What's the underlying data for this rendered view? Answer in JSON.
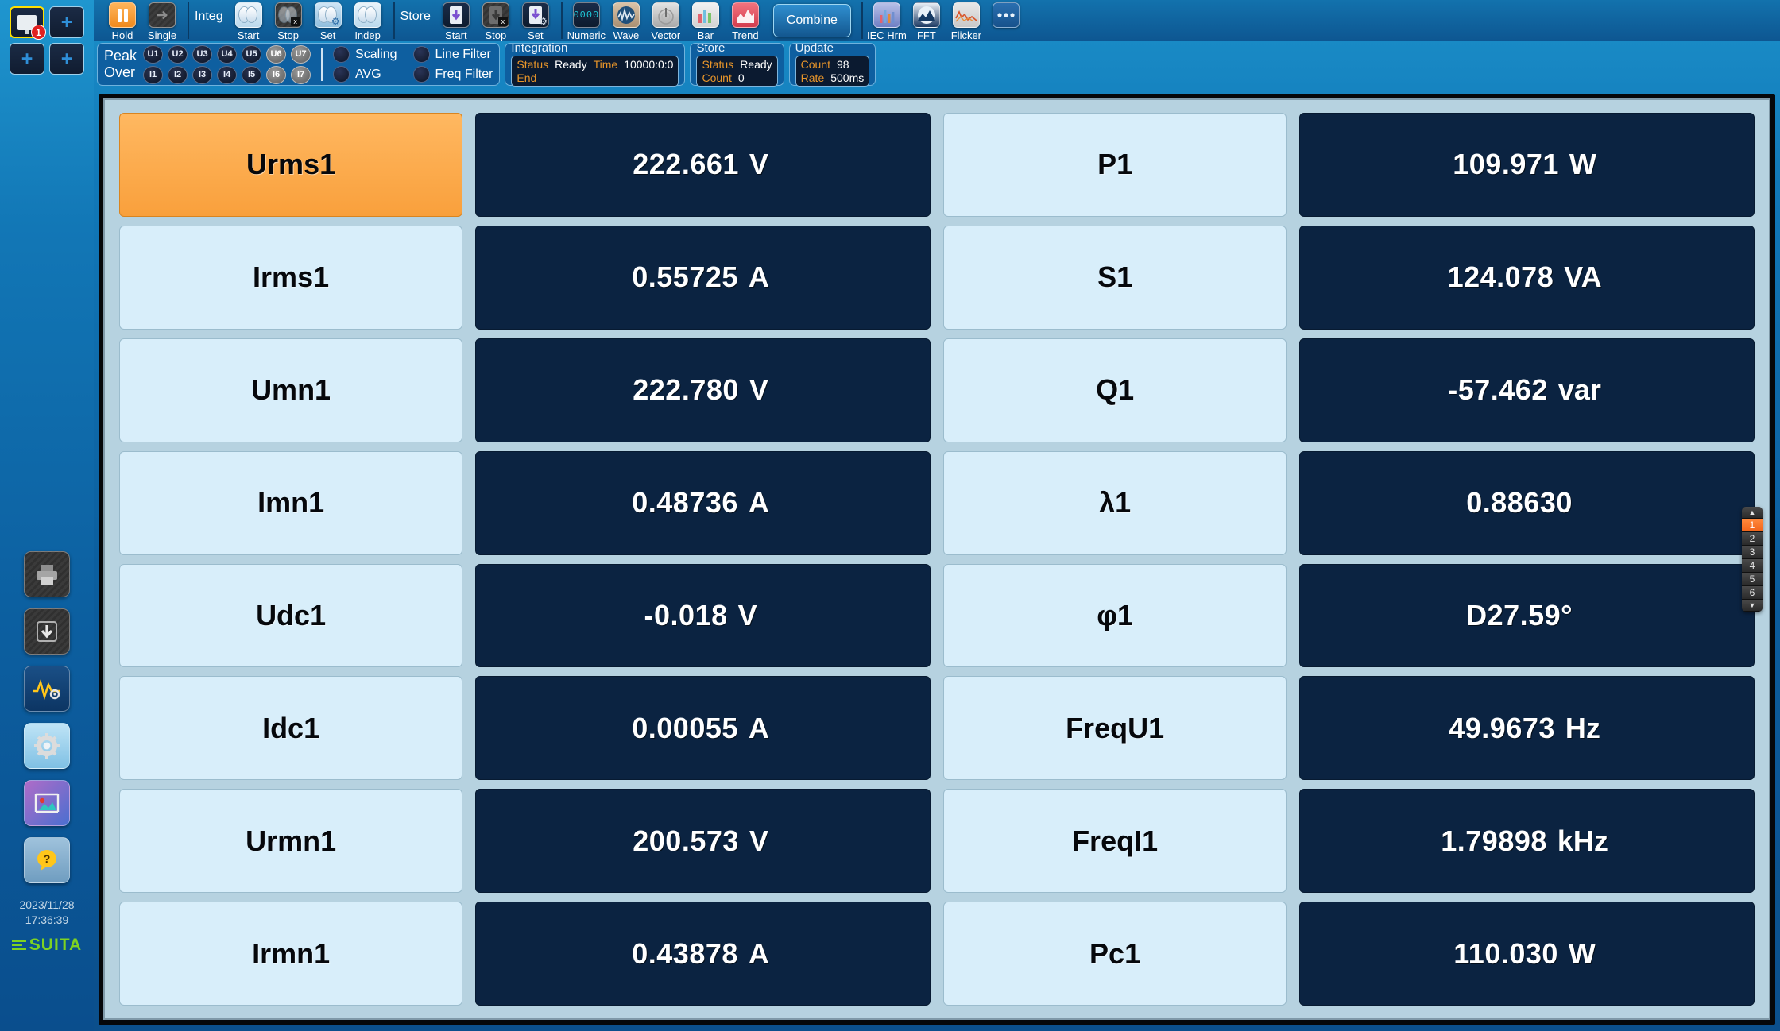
{
  "window_tiles": [
    {
      "name": "monitor-1",
      "badge": "1",
      "active": true
    },
    {
      "name": "add-2",
      "label": "+",
      "active": false
    },
    {
      "name": "add-3",
      "label": "+",
      "active": false
    },
    {
      "name": "add-4",
      "label": "+",
      "active": false
    }
  ],
  "sidebar": {
    "icons": [
      "print-icon",
      "save-icon",
      "waveform-settings-icon",
      "gear-icon",
      "image-capture-icon",
      "help-icon"
    ],
    "date": "2023/11/28",
    "time": "17:36:39",
    "logo": "SUITA"
  },
  "toolbar": {
    "groups": [
      {
        "name": "run-control",
        "title": "",
        "buttons": [
          {
            "label": "Hold",
            "icon": "pause-icon"
          },
          {
            "label": "Single",
            "icon": "single-arrow-icon"
          }
        ]
      },
      {
        "name": "integration",
        "title": "Integ",
        "buttons": [
          {
            "label": "Start",
            "icon": "integ-start-icon"
          },
          {
            "label": "Stop",
            "icon": "integ-stop-icon"
          },
          {
            "label": "Set",
            "icon": "integ-set-icon"
          },
          {
            "label": "Indep",
            "icon": "integ-indep-icon"
          }
        ]
      },
      {
        "name": "store",
        "title": "Store",
        "buttons": [
          {
            "label": "Start",
            "icon": "store-start-icon"
          },
          {
            "label": "Stop",
            "icon": "store-stop-icon"
          },
          {
            "label": "Set",
            "icon": "store-set-icon"
          }
        ]
      },
      {
        "name": "views",
        "title": "",
        "buttons": [
          {
            "label": "Numeric",
            "icon": "numeric-icon"
          },
          {
            "label": "Wave",
            "icon": "wave-icon"
          },
          {
            "label": "Vector",
            "icon": "vector-icon"
          },
          {
            "label": "Bar",
            "icon": "bar-icon"
          },
          {
            "label": "Trend",
            "icon": "trend-icon"
          }
        ]
      },
      {
        "name": "analysis",
        "title": "",
        "buttons": [
          {
            "label": "IEC Hrm",
            "icon": "iec-harmonics-icon"
          },
          {
            "label": "FFT",
            "icon": "fft-icon"
          },
          {
            "label": "Flicker",
            "icon": "flicker-icon"
          }
        ]
      }
    ],
    "combine_label": "Combine",
    "more_label": "more-options-icon"
  },
  "status_bar": {
    "peak_over": {
      "title_line1": "Peak",
      "title_line2": "Over",
      "voltage": [
        {
          "label": "U1",
          "on": false
        },
        {
          "label": "U2",
          "on": false
        },
        {
          "label": "U3",
          "on": false
        },
        {
          "label": "U4",
          "on": false
        },
        {
          "label": "U5",
          "on": false
        },
        {
          "label": "U6",
          "on": true
        },
        {
          "label": "U7",
          "on": true
        }
      ],
      "current": [
        {
          "label": "I1",
          "on": false
        },
        {
          "label": "I2",
          "on": false
        },
        {
          "label": "I3",
          "on": false
        },
        {
          "label": "I4",
          "on": false
        },
        {
          "label": "I5",
          "on": false
        },
        {
          "label": "I6",
          "on": true
        },
        {
          "label": "I7",
          "on": true
        }
      ]
    },
    "toggles": [
      {
        "label": "Scaling",
        "on": false
      },
      {
        "label": "AVG",
        "on": false
      },
      {
        "label": "Line Filter",
        "on": false
      },
      {
        "label": "Freq Filter",
        "on": false
      }
    ],
    "integration": {
      "title": "Integration",
      "status_key": "Status",
      "status_value": "Ready",
      "time_key": "Time",
      "time_value": "10000:0:0",
      "end_key": "End",
      "end_value": ""
    },
    "store": {
      "title": "Store",
      "status_key": "Status",
      "status_value": "Ready",
      "count_key": "Count",
      "count_value": "0"
    },
    "update": {
      "title": "Update",
      "count_key": "Count",
      "count_value": "98",
      "rate_key": "Rate",
      "rate_value": "500ms"
    }
  },
  "measurements": {
    "left": [
      {
        "label": "Urms1",
        "selected": true,
        "num": "222.661",
        "unit": "V"
      },
      {
        "label": "Irms1",
        "selected": false,
        "num": "0.55725",
        "unit": "A"
      },
      {
        "label": "Umn1",
        "selected": false,
        "num": "222.780",
        "unit": "V"
      },
      {
        "label": "Imn1",
        "selected": false,
        "num": "0.48736",
        "unit": "A"
      },
      {
        "label": "Udc1",
        "selected": false,
        "num": "-0.018",
        "unit": "V"
      },
      {
        "label": "Idc1",
        "selected": false,
        "num": "0.00055",
        "unit": "A"
      },
      {
        "label": "Urmn1",
        "selected": false,
        "num": "200.573",
        "unit": "V"
      },
      {
        "label": "Irmn1",
        "selected": false,
        "num": "0.43878",
        "unit": "A"
      }
    ],
    "right": [
      {
        "label": "P1",
        "selected": false,
        "num": "109.971",
        "unit": "W"
      },
      {
        "label": "S1",
        "selected": false,
        "num": "124.078",
        "unit": "VA"
      },
      {
        "label": "Q1",
        "selected": false,
        "num": "-57.462",
        "unit": "var"
      },
      {
        "label": "λ1",
        "selected": false,
        "num": "0.88630",
        "unit": ""
      },
      {
        "label": "φ1",
        "selected": false,
        "num": "D27.59°",
        "unit": ""
      },
      {
        "label": "FreqU1",
        "selected": false,
        "num": "49.9673",
        "unit": "Hz"
      },
      {
        "label": "FreqI1",
        "selected": false,
        "num": "1.79898",
        "unit": "kHz"
      },
      {
        "label": "Pc1",
        "selected": false,
        "num": "110.030",
        "unit": "W"
      }
    ]
  },
  "pager": {
    "up": "▲",
    "down": "▼",
    "pages": [
      "1",
      "2",
      "3",
      "4",
      "5",
      "6"
    ],
    "active": "1"
  },
  "colors": {
    "accent_orange": "#f9a03c",
    "value_bg": "#0b2341",
    "label_bg": "#d8eefa",
    "screen_bg": "#b6d2e0",
    "chrome_blue": "#0d5691",
    "logo_green": "#7ed321",
    "status_key": "#e8952a"
  }
}
